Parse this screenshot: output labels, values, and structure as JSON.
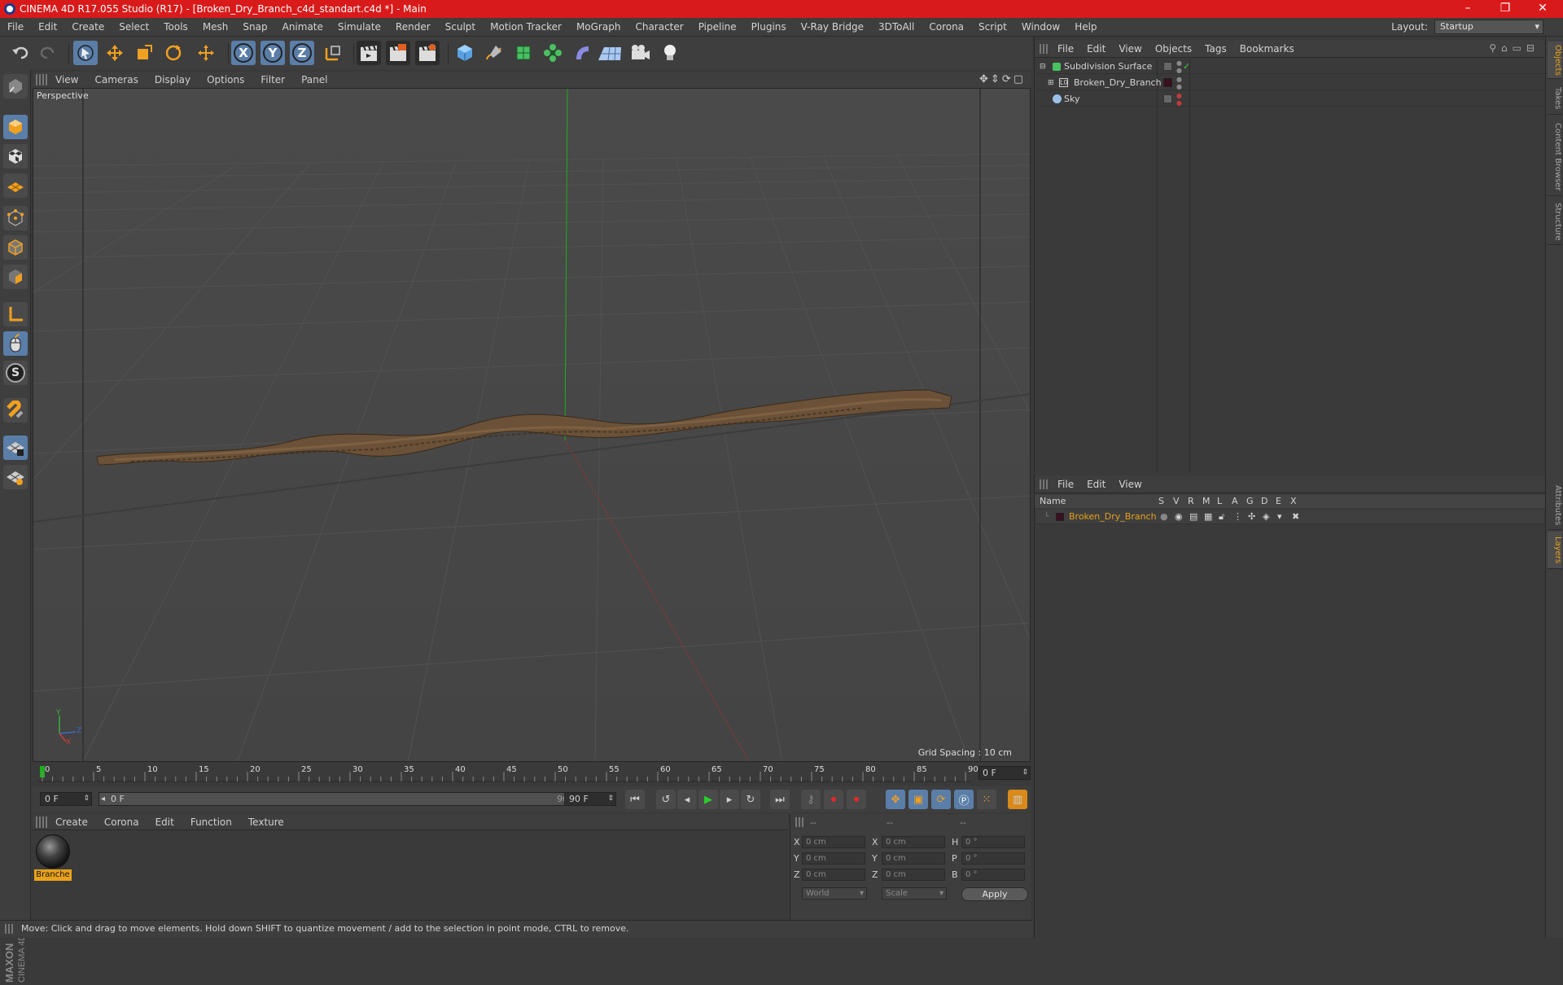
{
  "app": {
    "title": "CINEMA 4D R17.055 Studio (R17) - [Broken_Dry_Branch_c4d_standart.c4d *] - Main",
    "window_controls": [
      "–",
      "❐",
      "✕"
    ]
  },
  "menubar": {
    "items": [
      "File",
      "Edit",
      "Create",
      "Select",
      "Tools",
      "Mesh",
      "Snap",
      "Animate",
      "Simulate",
      "Render",
      "Sculpt",
      "Motion Tracker",
      "MoGraph",
      "Character",
      "Pipeline",
      "Plugins",
      "V-Ray Bridge",
      "3DToAll",
      "Corona",
      "Script",
      "Window",
      "Help"
    ],
    "layout_label": "Layout:",
    "layout_value": "Startup"
  },
  "toolbar": {
    "axis_x": "X",
    "axis_y": "Y",
    "axis_z": "Z"
  },
  "left_tools": {
    "s_label": "S"
  },
  "viewport": {
    "menu": [
      "View",
      "Cameras",
      "Display",
      "Options",
      "Filter",
      "Panel"
    ],
    "label": "Perspective",
    "grid_spacing": "Grid Spacing : 10 cm",
    "axis_y": "Y",
    "axis_x": "X",
    "axis_z": "Z"
  },
  "timeline": {
    "ticks": [
      "0",
      "5",
      "10",
      "15",
      "20",
      "25",
      "30",
      "35",
      "40",
      "45",
      "50",
      "55",
      "60",
      "65",
      "70",
      "75",
      "80",
      "85",
      "90"
    ],
    "current_frame": "0 F"
  },
  "transport": {
    "start_field": "0 F",
    "slider_start": "0 F",
    "slider_end": "90 F",
    "end_field": "90 F"
  },
  "materials": {
    "menu": [
      "Create",
      "Corona",
      "Edit",
      "Function",
      "Texture"
    ],
    "items": [
      {
        "name": "Branche"
      }
    ]
  },
  "coordinates": {
    "header": [
      "--",
      "--",
      "--"
    ],
    "rows": [
      {
        "a": "X",
        "v1": "0 cm",
        "b": "X",
        "v2": "0 cm",
        "c": "H",
        "v3": "0 °"
      },
      {
        "a": "Y",
        "v1": "0 cm",
        "b": "Y",
        "v2": "0 cm",
        "c": "P",
        "v3": "0 °"
      },
      {
        "a": "Z",
        "v1": "0 cm",
        "b": "Z",
        "v2": "0 cm",
        "c": "B",
        "v3": "0 °"
      }
    ],
    "mode_world": "World",
    "mode_scale": "Scale",
    "apply": "Apply"
  },
  "status": {
    "text": "Move: Click and drag to move elements. Hold down SHIFT to quantize movement / add to the selection in point mode, CTRL to remove."
  },
  "object_manager": {
    "menu": [
      "File",
      "Edit",
      "View",
      "Objects",
      "Tags",
      "Bookmarks"
    ],
    "objects": [
      {
        "name": "Subdivision Surface",
        "level": 0
      },
      {
        "name": "Broken_Dry_Branch",
        "level": 1
      },
      {
        "name": "Sky",
        "level": 0
      }
    ]
  },
  "layer_manager": {
    "menu": [
      "File",
      "Edit",
      "View"
    ],
    "name_header": "Name",
    "columns": [
      "S",
      "V",
      "R",
      "M",
      "L",
      "A",
      "G",
      "D",
      "E",
      "X"
    ],
    "layers": [
      {
        "name": "Broken_Dry_Branch",
        "color": "#e8a21a"
      }
    ]
  },
  "right_tabs": [
    "Objects",
    "Takes",
    "Content Browser",
    "Structure",
    "Attributes",
    "Layers"
  ],
  "colors": {
    "titlebar": "#d91a1a",
    "accent_orange": "#e8a21a",
    "selection_blue": "#5a7ea8",
    "viewport_bg": "#474747"
  }
}
